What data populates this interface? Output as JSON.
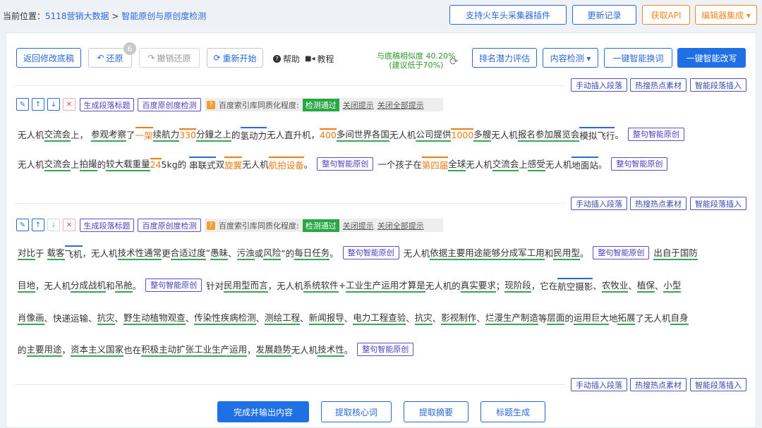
{
  "breadcrumb": {
    "prefix": "当前位置：",
    "link1": "5118营销大数据",
    "sep": " > ",
    "link2": "智能原创与原创度检测"
  },
  "topbar": {
    "plugin": "支持火车头采集器插件",
    "changelog": "更新记录",
    "api": "获取API",
    "editor": "编辑器集成 ▾"
  },
  "toolbar": {
    "back_edit": "返回修改底稿",
    "restore": "还原",
    "restore_count": "6",
    "undo_restore": "撤销还原",
    "restart": "重新开始",
    "help": "帮助",
    "tutorial": "教程",
    "similarity_line1": "与底稿相似度 40.20%",
    "similarity_line2": "(建议低于70%)",
    "rank_eval": "排名潜力评估",
    "content_check": "内容检测 ▾",
    "one_click_replace": "一键智能换词",
    "one_click_rewrite": "一键智能改写"
  },
  "insert_actions": {
    "manual_insert": "手动插入段落",
    "hot_material": "热搜热点素材",
    "smart_insert": "智能段落插入"
  },
  "para_tools": {
    "gen_title": "生成段落标题",
    "baidu_check": "百度原创度检测",
    "index_label": "百度索引库同质化程度:",
    "pass": "检测通过",
    "close_tip": "关闭提示",
    "close_all": "关闭全部提示"
  },
  "tag_label": "整句智能原创",
  "paragraph1": {
    "line1": {
      "t1": "无人机",
      "g1": "交流会",
      "t2": "上，",
      "g2": "参观考察",
      "t3": "了",
      "o1": "一架",
      "g3": "续航力",
      "o2": "330",
      "g4": "分鐘",
      "g5": "之上",
      "t4": "的",
      "b1": "氢动力",
      "t5": "无人直升机，",
      "o3": "400",
      "g6": "多间",
      "g7": "世界各国",
      "t6": "无人机",
      "g8": "公司",
      "g9": "提供",
      "o4": "1000",
      "g10": "多艘",
      "t7": "无人机",
      "g11": "报名参加",
      "g12": "展览会",
      "b2": "模拟飞行",
      "t8": "。"
    },
    "line2": {
      "t1": "无人机",
      "g1": "交流会",
      "t2": "上",
      "g2": "拍撮",
      "t3": "的",
      "g3": "较大",
      "g4": "载重量",
      "o1": "24",
      "t4": "5kg的",
      "b1": "串联式",
      "t5": "双",
      "o2": "旋翼",
      "t6": "无人机",
      "o3": "航拍设备",
      "t7": "。",
      "s1": "一个孩子在",
      "o4": "第四届",
      "g5": "全球",
      "t8": "无人机",
      "g6": "交流会",
      "t9": "上",
      "g7": "感受",
      "t10": "无人机",
      "b2": "地面站",
      "t11": "。"
    }
  },
  "paragraph2": {
    "line1": {
      "t1": "对比",
      "t2": "于",
      "g1": "载客",
      "b1": "飞机",
      "t3": "，无人机",
      "g2": "技术性",
      "g3": "通常",
      "t4": "更",
      "g4": "合适",
      "g5": "过度",
      "t5": "“",
      "g6": "愚昧",
      "t6": "、",
      "g7": "污浊",
      "t7": "或",
      "g8": "风险",
      "t8": "”的",
      "g9": "每日任务",
      "t9": "。",
      "s1": "无人机",
      "g10": "依据",
      "g11": "主要用途",
      "g12": "能够",
      "g13": "分成",
      "g14": "军工用",
      "t10": "和",
      "g15": "民用型",
      "t11": "。",
      "g16": "出自于",
      "g17": "国防"
    },
    "line2": {
      "g1": "目地",
      "t1": "，无人机",
      "g2": "分成",
      "g3": "战机",
      "t2": "和",
      "g4": "吊舱",
      "t3": "。",
      "t4": "针对",
      "g5": "民用型",
      "g6": "而言",
      "t5": "，无人机",
      "g7": "系统软件",
      "t6": "+",
      "g8": "工业生产",
      "g9": "运用",
      "g10": "才算是",
      "t7": "无人机的",
      "g11": "真实",
      "g12": "要求",
      "t8": "；",
      "g13": "现阶段",
      "t9": "，它在",
      "b1": "航空摄影",
      "t10": "、",
      "g14": "农牧业",
      "t11": "、",
      "g15": "植保",
      "t12": "、",
      "g16": "小型"
    },
    "line3": {
      "g1": "肖像画",
      "t1": "、快递运输、",
      "g2": "抗灾",
      "t2": "、",
      "g3": "野生动植物",
      "g4": "观查",
      "t3": "、",
      "g5": "传染性疾病",
      "g6": "检测",
      "t4": "、",
      "g7": "测绘工程",
      "t5": "、",
      "g8": "新闻报导",
      "t6": "、",
      "g9": "电力工程",
      "g10": "查验",
      "t7": "、",
      "g11": "抗灾",
      "t8": "、",
      "g12": "影视制作",
      "t9": "、",
      "g13": "烂漫",
      "g14": "生产制造",
      "t10": "等",
      "g15": "层面",
      "t11": "的",
      "g16": "运用",
      "g17": "巨大",
      "t12": "地",
      "g18": "拓展",
      "t13": "了无人机",
      "g19": "自身"
    },
    "line4": {
      "t1": "的",
      "g1": "主要用途",
      "t2": "，",
      "g2": "资本主义国家",
      "t3": "也在",
      "g3": "积极主动",
      "g4": "扩张",
      "g5": "工业生产",
      "g6": "运用",
      "t4": "，",
      "g7": "发展趋势",
      "t5": "无人机",
      "g8": "技术性",
      "t6": "。"
    }
  },
  "bottom": {
    "finish": "完成并输出内容",
    "keywords": "提取核心词",
    "summary": "提取摘要",
    "title_gen": "标题生成"
  },
  "colors": {
    "accent": "#1f6fe5",
    "orange": "#f08a24",
    "green_underline": "#34a853",
    "pass_green": "#28a745"
  }
}
